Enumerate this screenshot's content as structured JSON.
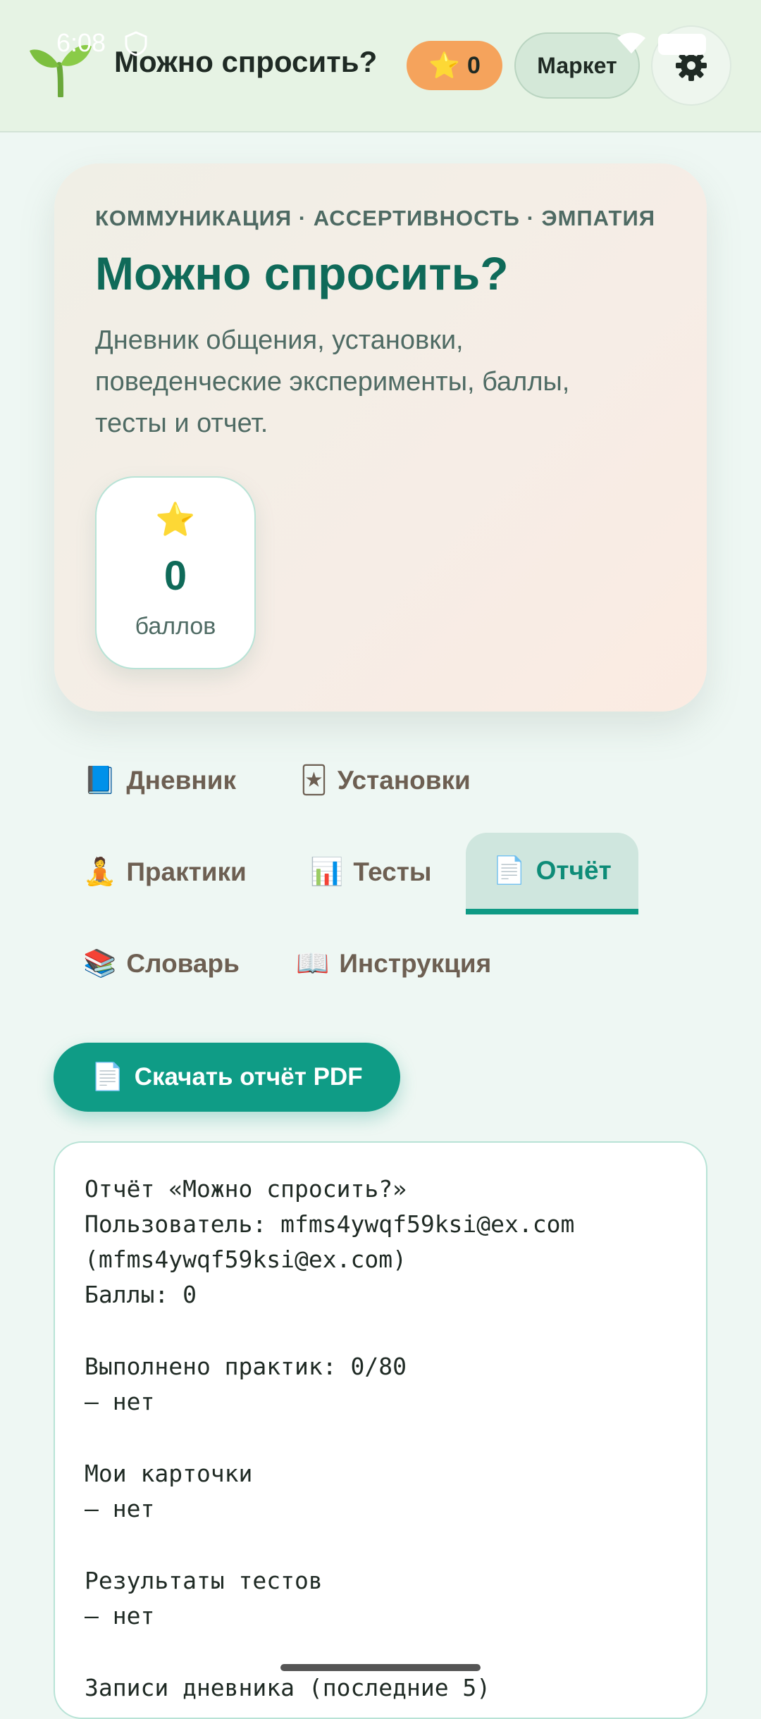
{
  "status_bar": {
    "time": "6:08"
  },
  "header": {
    "title": "Можно спросить?",
    "points": "0",
    "points_icon": "⭐",
    "market_label": "Маркет",
    "settings_icon": "gear-icon"
  },
  "hero": {
    "kicker": "КОММУНИКАЦИЯ · АССЕРТИВНОСТЬ · ЭМПАТИЯ",
    "title": "Можно спросить?",
    "description": "Дневник общения, установки, поведенческие эксперименты, баллы, тесты и отчет.",
    "score": {
      "icon": "⭐",
      "value": "0",
      "label": "баллов"
    }
  },
  "tabs": [
    {
      "icon": "📘",
      "label": "Дневник",
      "active": false
    },
    {
      "icon": "🃏",
      "label": "Установки",
      "active": false
    },
    {
      "icon": "🧘",
      "label": "Практики",
      "active": false
    },
    {
      "icon": "📊",
      "label": "Тесты",
      "active": false
    },
    {
      "icon": "📄",
      "label": "Отчёт",
      "active": true
    },
    {
      "icon": "📚",
      "label": "Словарь",
      "active": false
    },
    {
      "icon": "📖",
      "label": "Инструкция",
      "active": false
    }
  ],
  "download": {
    "icon": "📄",
    "label": "Скачать отчёт PDF"
  },
  "report_lines": [
    "Отчёт «Можно спросить?»",
    "Пользователь: mfms4ywqf59ksi@ex.com",
    "(mfms4ywqf59ksi@ex.com)",
    "Баллы: 0",
    "",
    "Выполнено практик: 0/80",
    "— нет",
    "",
    "Мои карточки",
    "— нет",
    "",
    "Результаты тестов",
    "— нет",
    "",
    "Записи дневника (последние 5)"
  ],
  "colors": {
    "accent": "#0f9c86",
    "title_green": "#0f6a59",
    "points_orange": "#f5a35c",
    "appbar": "#e6f3e4"
  }
}
